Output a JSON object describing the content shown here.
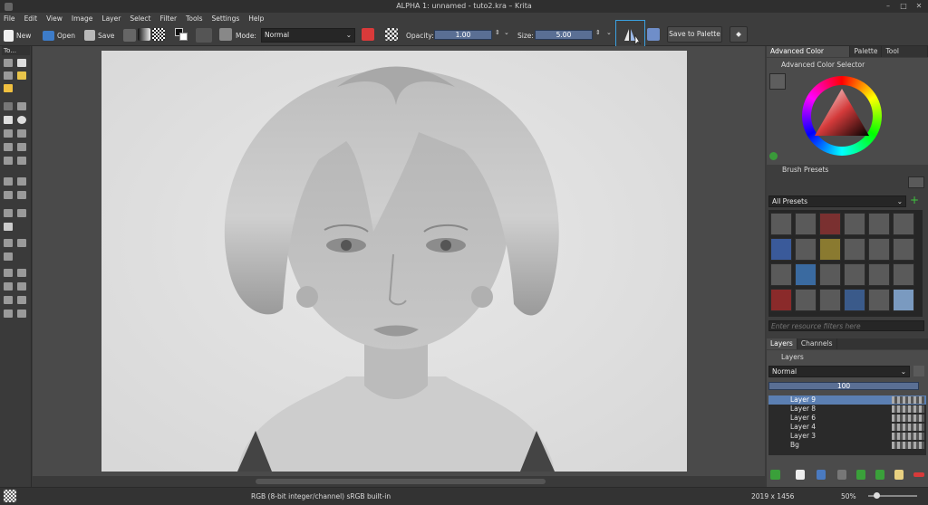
{
  "window": {
    "title": "ALPHA 1: unnamed - tuto2.kra – Krita"
  },
  "menu": [
    "File",
    "Edit",
    "View",
    "Image",
    "Layer",
    "Select",
    "Filter",
    "Tools",
    "Settings",
    "Help"
  ],
  "toolbar": {
    "new_label": "New",
    "open_label": "Open",
    "save_label": "Save",
    "mode_label": "Mode:",
    "mode_value": "Normal",
    "opacity_label": "Opacity:",
    "opacity_value": "1.00",
    "size_label": "Size:",
    "size_value": "5.00",
    "save_palette_label": "Save to Palette"
  },
  "toolbox": {
    "title": "To..."
  },
  "dock": {
    "tabs": [
      "Advanced Color Selector",
      "Palette",
      "Tool Options"
    ],
    "color_selector_title": "Advanced Color Selector",
    "brush_presets_title": "Brush Presets",
    "presets_filter": "All Presets",
    "resource_filter_placeholder": "Enter resource filters here",
    "layer_tabs": [
      "Layers",
      "Channels"
    ],
    "layers_title": "Layers",
    "blend_mode": "Normal",
    "layer_opacity": "100",
    "layers": [
      "Layer 9",
      "Layer 8",
      "Layer 6",
      "Layer 4",
      "Layer 3",
      "Bg"
    ]
  },
  "status": {
    "color_space": "RGB (8-bit integer/channel)  sRGB built-in",
    "dimensions": "2019 x 1456",
    "zoom": "50%"
  },
  "colors": {
    "accent": "#5b7fb2",
    "highlight": "#3aa0e0"
  }
}
